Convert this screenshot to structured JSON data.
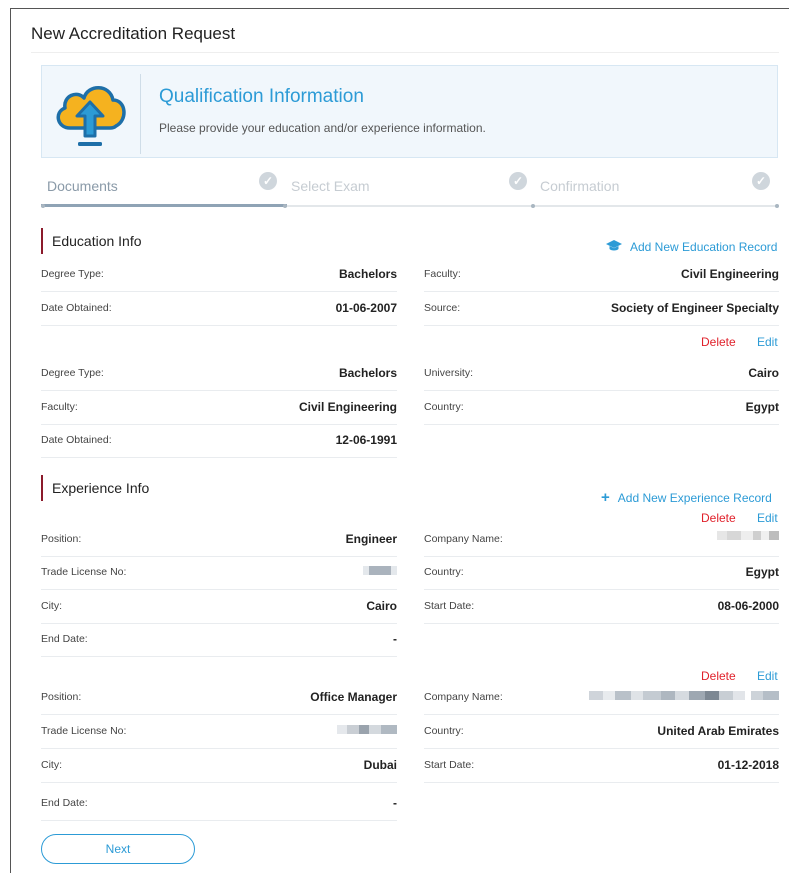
{
  "page_title": "New Accreditation Request",
  "banner": {
    "title": "Qualification Information",
    "subtitle": "Please provide your education and/or experience information.",
    "icon": "cloud-upload-icon",
    "colors": {
      "cloud": "#f5b21f",
      "arrow": "#1e6fa8",
      "accent": "#2c9bd6"
    }
  },
  "steps": [
    {
      "label": "Documents",
      "state": "active"
    },
    {
      "label": "Select Exam",
      "state": "pending"
    },
    {
      "label": "Confirmation",
      "state": "pending"
    }
  ],
  "step_progress": 0.333,
  "education": {
    "heading": "Education Info",
    "add_label": "Add New Education Record",
    "add_icon": "graduation-cap-icon",
    "delete_label": "Delete",
    "edit_label": "Edit",
    "records": [
      {
        "left": [
          {
            "label": "Degree Type:",
            "value": "Bachelors"
          },
          {
            "label": "Date Obtained:",
            "value": "01-06-2007"
          }
        ],
        "right": [
          {
            "label": "Faculty:",
            "value": "Civil Engineering"
          },
          {
            "label": "Source:",
            "value": "Society of Engineer Specialty"
          }
        ]
      },
      {
        "left": [
          {
            "label": "Degree Type:",
            "value": "Bachelors"
          },
          {
            "label": "Faculty:",
            "value": "Civil Engineering"
          },
          {
            "label": "Date Obtained:",
            "value": "12-06-1991"
          }
        ],
        "right": [
          {
            "label": "University:",
            "value": "Cairo"
          },
          {
            "label": "Country:",
            "value": "Egypt"
          }
        ]
      }
    ]
  },
  "experience": {
    "heading": "Experience Info",
    "add_label": "Add New Experience Record",
    "add_icon": "plus-icon",
    "delete_label": "Delete",
    "edit_label": "Edit",
    "records": [
      {
        "left": [
          {
            "label": "Position:",
            "value": "Engineer"
          },
          {
            "label": "Trade License No:",
            "value": ""
          },
          {
            "label": "City:",
            "value": "Cairo"
          },
          {
            "label": "End Date:",
            "value": "-"
          }
        ],
        "right": [
          {
            "label": "Company Name:",
            "value": ""
          },
          {
            "label": "Country:",
            "value": "Egypt"
          },
          {
            "label": "Start Date:",
            "value": "08-06-2000"
          }
        ]
      },
      {
        "left": [
          {
            "label": "Position:",
            "value": "Office Manager"
          },
          {
            "label": "Trade License No:",
            "value": ""
          },
          {
            "label": "City:",
            "value": "Dubai"
          },
          {
            "label": "End Date:",
            "value": "-"
          }
        ],
        "right": [
          {
            "label": "Company Name:",
            "value": ""
          },
          {
            "label": "Country:",
            "value": "United Arab Emirates"
          },
          {
            "label": "Start Date:",
            "value": "01-12-2018"
          }
        ]
      }
    ]
  },
  "next_label": "Next"
}
